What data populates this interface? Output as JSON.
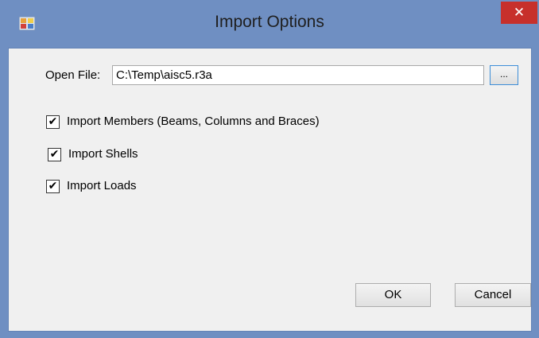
{
  "window": {
    "title": "Import Options",
    "close_glyph": "✕"
  },
  "open_file": {
    "label": "Open File:",
    "value": "C:\\Temp\\aisc5.r3a",
    "browse_label": "..."
  },
  "options": [
    {
      "label": "Import Members (Beams, Columns and Braces)",
      "checked": true
    },
    {
      "label": "Import Shells",
      "checked": true
    },
    {
      "label": "Import Loads",
      "checked": true
    }
  ],
  "buttons": {
    "ok": "OK",
    "cancel": "Cancel"
  },
  "check_glyph": "✔",
  "colors": {
    "title_bar": "#6f8fc2",
    "close_button": "#c7302b",
    "client": "#f0f0f0"
  }
}
